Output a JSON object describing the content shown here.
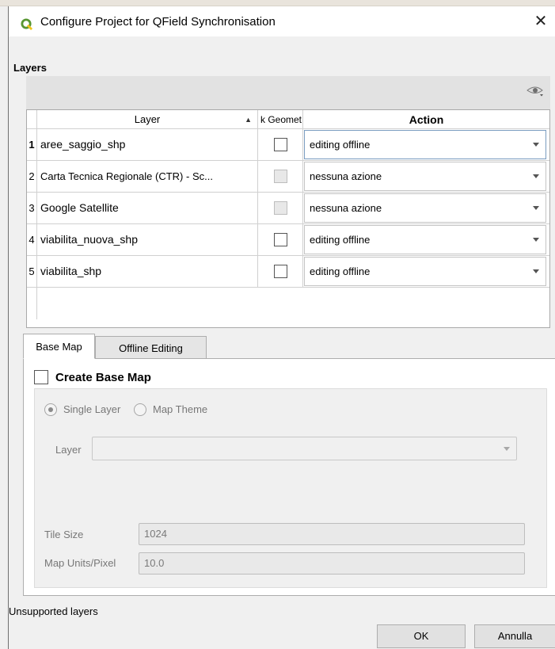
{
  "window": {
    "title": "Configure Project for QField Synchronisation",
    "close_label": "✕"
  },
  "layers_section": {
    "label": "Layers",
    "table": {
      "headers": {
        "layer": "Layer",
        "geometry": "k Geomet",
        "action": "Action"
      },
      "rows": [
        {
          "num": "1",
          "layer": "aree_saggio_shp",
          "checkbox_enabled": true,
          "action": "editing offline"
        },
        {
          "num": "2",
          "layer": "Carta Tecnica Regionale  (CTR) - Sc...",
          "checkbox_enabled": false,
          "action": "nessuna azione"
        },
        {
          "num": "3",
          "layer": "Google Satellite",
          "checkbox_enabled": false,
          "action": "nessuna azione"
        },
        {
          "num": "4",
          "layer": "viabilita_nuova_shp",
          "checkbox_enabled": true,
          "action": "editing offline"
        },
        {
          "num": "5",
          "layer": "viabilita_shp",
          "checkbox_enabled": true,
          "action": "editing offline"
        }
      ]
    }
  },
  "tabs": [
    {
      "label": "Base Map",
      "active": true
    },
    {
      "label": "Offline Editing",
      "active": false
    }
  ],
  "base_map": {
    "create_label": "Create Base Map",
    "create_checked": false,
    "single_layer_label": "Single Layer",
    "map_theme_label": "Map Theme",
    "selected_mode": "Single Layer",
    "layer_label": "Layer",
    "layer_value": "",
    "tile_size_label": "Tile Size",
    "tile_size_value": "1024",
    "map_units_label": "Map Units/Pixel",
    "map_units_value": "10.0"
  },
  "footer": {
    "unsupported_label": "Unsupported layers",
    "ok_label": "OK",
    "cancel_label": "Annulla"
  },
  "icons": {
    "app": "qgis-logo-icon",
    "eye": "eye-visibility-icon",
    "sort": "sort-ascending-icon",
    "combo_arrow": "chevron-down-icon"
  },
  "colors": {
    "qgis_green": "#589632",
    "qgis_yellow": "#f0c51c",
    "selected_border": "#7a9cc0"
  }
}
